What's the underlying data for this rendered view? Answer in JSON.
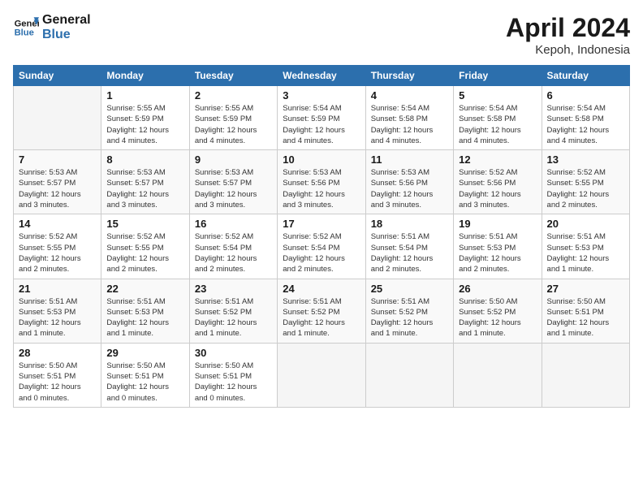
{
  "header": {
    "logo_line1": "General",
    "logo_line2": "Blue",
    "month_year": "April 2024",
    "location": "Kepoh, Indonesia"
  },
  "days_of_week": [
    "Sunday",
    "Monday",
    "Tuesday",
    "Wednesday",
    "Thursday",
    "Friday",
    "Saturday"
  ],
  "weeks": [
    [
      {
        "num": "",
        "info": ""
      },
      {
        "num": "1",
        "info": "Sunrise: 5:55 AM\nSunset: 5:59 PM\nDaylight: 12 hours\nand 4 minutes."
      },
      {
        "num": "2",
        "info": "Sunrise: 5:55 AM\nSunset: 5:59 PM\nDaylight: 12 hours\nand 4 minutes."
      },
      {
        "num": "3",
        "info": "Sunrise: 5:54 AM\nSunset: 5:59 PM\nDaylight: 12 hours\nand 4 minutes."
      },
      {
        "num": "4",
        "info": "Sunrise: 5:54 AM\nSunset: 5:58 PM\nDaylight: 12 hours\nand 4 minutes."
      },
      {
        "num": "5",
        "info": "Sunrise: 5:54 AM\nSunset: 5:58 PM\nDaylight: 12 hours\nand 4 minutes."
      },
      {
        "num": "6",
        "info": "Sunrise: 5:54 AM\nSunset: 5:58 PM\nDaylight: 12 hours\nand 4 minutes."
      }
    ],
    [
      {
        "num": "7",
        "info": "Sunrise: 5:53 AM\nSunset: 5:57 PM\nDaylight: 12 hours\nand 3 minutes."
      },
      {
        "num": "8",
        "info": "Sunrise: 5:53 AM\nSunset: 5:57 PM\nDaylight: 12 hours\nand 3 minutes."
      },
      {
        "num": "9",
        "info": "Sunrise: 5:53 AM\nSunset: 5:57 PM\nDaylight: 12 hours\nand 3 minutes."
      },
      {
        "num": "10",
        "info": "Sunrise: 5:53 AM\nSunset: 5:56 PM\nDaylight: 12 hours\nand 3 minutes."
      },
      {
        "num": "11",
        "info": "Sunrise: 5:53 AM\nSunset: 5:56 PM\nDaylight: 12 hours\nand 3 minutes."
      },
      {
        "num": "12",
        "info": "Sunrise: 5:52 AM\nSunset: 5:56 PM\nDaylight: 12 hours\nand 3 minutes."
      },
      {
        "num": "13",
        "info": "Sunrise: 5:52 AM\nSunset: 5:55 PM\nDaylight: 12 hours\nand 2 minutes."
      }
    ],
    [
      {
        "num": "14",
        "info": "Sunrise: 5:52 AM\nSunset: 5:55 PM\nDaylight: 12 hours\nand 2 minutes."
      },
      {
        "num": "15",
        "info": "Sunrise: 5:52 AM\nSunset: 5:55 PM\nDaylight: 12 hours\nand 2 minutes."
      },
      {
        "num": "16",
        "info": "Sunrise: 5:52 AM\nSunset: 5:54 PM\nDaylight: 12 hours\nand 2 minutes."
      },
      {
        "num": "17",
        "info": "Sunrise: 5:52 AM\nSunset: 5:54 PM\nDaylight: 12 hours\nand 2 minutes."
      },
      {
        "num": "18",
        "info": "Sunrise: 5:51 AM\nSunset: 5:54 PM\nDaylight: 12 hours\nand 2 minutes."
      },
      {
        "num": "19",
        "info": "Sunrise: 5:51 AM\nSunset: 5:53 PM\nDaylight: 12 hours\nand 2 minutes."
      },
      {
        "num": "20",
        "info": "Sunrise: 5:51 AM\nSunset: 5:53 PM\nDaylight: 12 hours\nand 1 minute."
      }
    ],
    [
      {
        "num": "21",
        "info": "Sunrise: 5:51 AM\nSunset: 5:53 PM\nDaylight: 12 hours\nand 1 minute."
      },
      {
        "num": "22",
        "info": "Sunrise: 5:51 AM\nSunset: 5:53 PM\nDaylight: 12 hours\nand 1 minute."
      },
      {
        "num": "23",
        "info": "Sunrise: 5:51 AM\nSunset: 5:52 PM\nDaylight: 12 hours\nand 1 minute."
      },
      {
        "num": "24",
        "info": "Sunrise: 5:51 AM\nSunset: 5:52 PM\nDaylight: 12 hours\nand 1 minute."
      },
      {
        "num": "25",
        "info": "Sunrise: 5:51 AM\nSunset: 5:52 PM\nDaylight: 12 hours\nand 1 minute."
      },
      {
        "num": "26",
        "info": "Sunrise: 5:50 AM\nSunset: 5:52 PM\nDaylight: 12 hours\nand 1 minute."
      },
      {
        "num": "27",
        "info": "Sunrise: 5:50 AM\nSunset: 5:51 PM\nDaylight: 12 hours\nand 1 minute."
      }
    ],
    [
      {
        "num": "28",
        "info": "Sunrise: 5:50 AM\nSunset: 5:51 PM\nDaylight: 12 hours\nand 0 minutes."
      },
      {
        "num": "29",
        "info": "Sunrise: 5:50 AM\nSunset: 5:51 PM\nDaylight: 12 hours\nand 0 minutes."
      },
      {
        "num": "30",
        "info": "Sunrise: 5:50 AM\nSunset: 5:51 PM\nDaylight: 12 hours\nand 0 minutes."
      },
      {
        "num": "",
        "info": ""
      },
      {
        "num": "",
        "info": ""
      },
      {
        "num": "",
        "info": ""
      },
      {
        "num": "",
        "info": ""
      }
    ]
  ]
}
